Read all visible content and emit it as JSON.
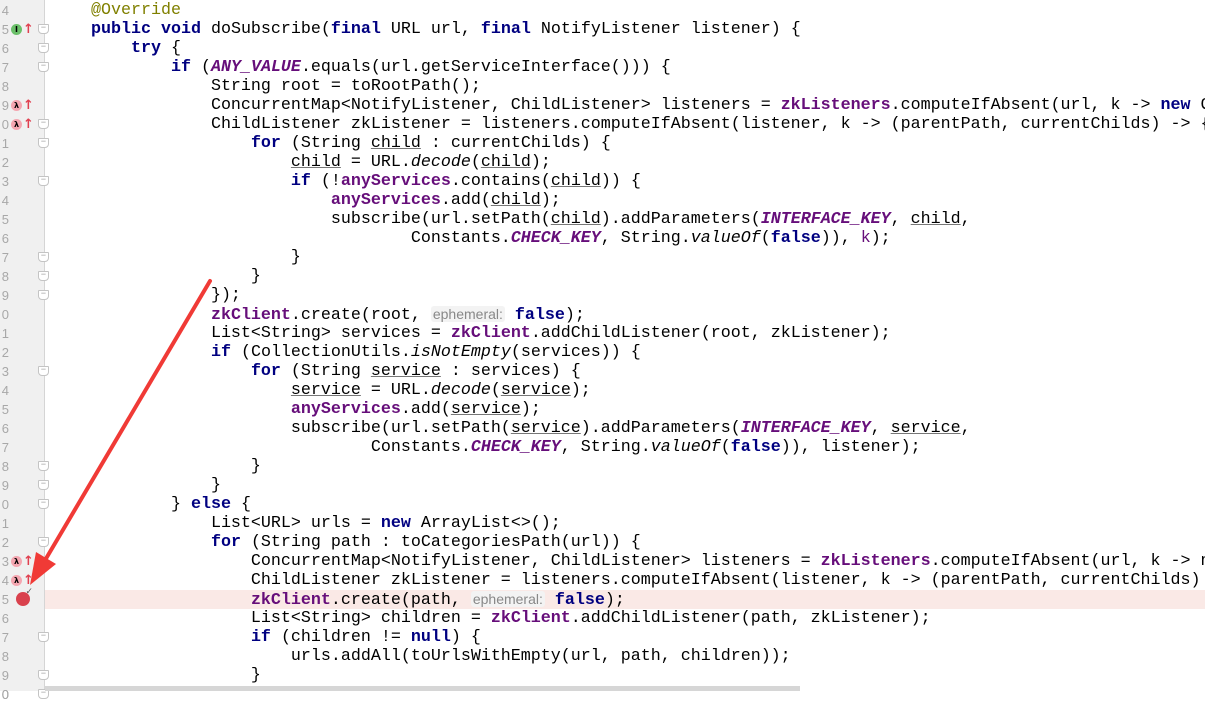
{
  "editor": {
    "line_numbers": [
      "4",
      "5",
      "6",
      "7",
      "8",
      "9",
      "0",
      "1",
      "2",
      "3",
      "4",
      "5",
      "6",
      "7",
      "8",
      "9",
      "0",
      "1",
      "2",
      "3",
      "4",
      "5",
      "6",
      "7",
      "8",
      "9",
      "0",
      "1",
      "2",
      "3",
      "4",
      "5",
      "6",
      "7",
      "8",
      "9",
      "0"
    ],
    "highlighted_line": 31,
    "breakpoint_line": 31,
    "gutter_icons": [
      {
        "line": 1,
        "icon": "implements-method-icon",
        "label": "I",
        "color": "#6abf69"
      },
      {
        "line": 5,
        "icon": "lambda-icon",
        "label": "λ",
        "color": "#f4a6b0"
      },
      {
        "line": 6,
        "icon": "lambda-icon",
        "label": "λ",
        "color": "#f4a6b0"
      },
      {
        "line": 29,
        "icon": "lambda-icon",
        "label": "λ",
        "color": "#f4a6b0"
      },
      {
        "line": 30,
        "icon": "lambda-icon",
        "label": "λ",
        "color": "#f4a6b0"
      }
    ],
    "fold_lines": [
      1,
      2,
      3,
      6,
      7,
      9,
      13,
      14,
      15,
      19,
      24,
      25,
      26,
      28,
      33,
      35,
      36
    ],
    "lines": [
      [
        [
          "a",
          "@Override"
        ]
      ],
      [
        [
          "k",
          "public void "
        ],
        [
          "p",
          "doSubscribe("
        ],
        [
          "k",
          "final "
        ],
        [
          "p",
          "URL url, "
        ],
        [
          "k",
          "final "
        ],
        [
          "p",
          "NotifyListener listener) {"
        ]
      ],
      [
        [
          "p",
          "    "
        ],
        [
          "k",
          "try "
        ],
        [
          "p",
          "{"
        ]
      ],
      [
        [
          "p",
          "        "
        ],
        [
          "k",
          "if "
        ],
        [
          "p",
          "("
        ],
        [
          "c",
          "ANY_VALUE"
        ],
        [
          "p",
          ".equals(url.getServiceInterface())) {"
        ]
      ],
      [
        [
          "p",
          "            String root = toRootPath();"
        ]
      ],
      [
        [
          "p",
          "            ConcurrentMap<NotifyListener, ChildListener> listeners = "
        ],
        [
          "f",
          "zkListeners"
        ],
        [
          "p",
          ".computeIfAbsent(url, k -> "
        ],
        [
          "k",
          "new "
        ],
        [
          "p",
          "C"
        ]
      ],
      [
        [
          "p",
          "            ChildListener zkListener = listeners.computeIfAbsent(listener, k -> (parentPath, currentChilds) -> {"
        ]
      ],
      [
        [
          "p",
          "                "
        ],
        [
          "k",
          "for "
        ],
        [
          "p",
          "(String "
        ],
        [
          "u",
          "child"
        ],
        [
          "p",
          " : currentChilds) {"
        ]
      ],
      [
        [
          "p",
          "                    "
        ],
        [
          "u",
          "child"
        ],
        [
          "p",
          " = URL."
        ],
        [
          "s",
          "decode"
        ],
        [
          "p",
          "("
        ],
        [
          "u",
          "child"
        ],
        [
          "p",
          ");"
        ]
      ],
      [
        [
          "p",
          "                    "
        ],
        [
          "k",
          "if "
        ],
        [
          "p",
          "(!"
        ],
        [
          "f",
          "anyServices"
        ],
        [
          "p",
          ".contains("
        ],
        [
          "u",
          "child"
        ],
        [
          "p",
          ")) {"
        ]
      ],
      [
        [
          "p",
          "                        "
        ],
        [
          "f",
          "anyServices"
        ],
        [
          "p",
          ".add("
        ],
        [
          "u",
          "child"
        ],
        [
          "p",
          ");"
        ]
      ],
      [
        [
          "p",
          "                        subscribe(url.setPath("
        ],
        [
          "u",
          "child"
        ],
        [
          "p",
          ").addParameters("
        ],
        [
          "c",
          "INTERFACE_KEY"
        ],
        [
          "p",
          ", "
        ],
        [
          "u",
          "child"
        ],
        [
          "p",
          ","
        ]
      ],
      [
        [
          "p",
          "                                Constants."
        ],
        [
          "c",
          "CHECK_KEY"
        ],
        [
          "p",
          ", String."
        ],
        [
          "s",
          "valueOf"
        ],
        [
          "p",
          "("
        ],
        [
          "k",
          "false"
        ],
        [
          "p",
          ")), "
        ],
        [
          "v",
          "k"
        ],
        [
          "p",
          ");"
        ]
      ],
      [
        [
          "p",
          "                    }"
        ]
      ],
      [
        [
          "p",
          "                }"
        ]
      ],
      [
        [
          "p",
          "            });"
        ]
      ],
      [
        [
          "p",
          "            "
        ],
        [
          "f",
          "zkClient"
        ],
        [
          "p",
          ".create(root, "
        ],
        [
          "h",
          "ephemeral:"
        ],
        [
          "p",
          " "
        ],
        [
          "k",
          "false"
        ],
        [
          "p",
          ");"
        ]
      ],
      [
        [
          "p",
          "            List<String> services = "
        ],
        [
          "f",
          "zkClient"
        ],
        [
          "p",
          ".addChildListener(root, zkListener);"
        ]
      ],
      [
        [
          "p",
          "            "
        ],
        [
          "k",
          "if "
        ],
        [
          "p",
          "(CollectionUtils."
        ],
        [
          "s",
          "isNotEmpty"
        ],
        [
          "p",
          "(services)) {"
        ]
      ],
      [
        [
          "p",
          "                "
        ],
        [
          "k",
          "for "
        ],
        [
          "p",
          "(String "
        ],
        [
          "u",
          "service"
        ],
        [
          "p",
          " : services) {"
        ]
      ],
      [
        [
          "p",
          "                    "
        ],
        [
          "u",
          "service"
        ],
        [
          "p",
          " = URL."
        ],
        [
          "s",
          "decode"
        ],
        [
          "p",
          "("
        ],
        [
          "u",
          "service"
        ],
        [
          "p",
          ");"
        ]
      ],
      [
        [
          "p",
          "                    "
        ],
        [
          "f",
          "anyServices"
        ],
        [
          "p",
          ".add("
        ],
        [
          "u",
          "service"
        ],
        [
          "p",
          ");"
        ]
      ],
      [
        [
          "p",
          "                    subscribe(url.setPath("
        ],
        [
          "u",
          "service"
        ],
        [
          "p",
          ").addParameters("
        ],
        [
          "c",
          "INTERFACE_KEY"
        ],
        [
          "p",
          ", "
        ],
        [
          "u",
          "service"
        ],
        [
          "p",
          ","
        ]
      ],
      [
        [
          "p",
          "                            Constants."
        ],
        [
          "c",
          "CHECK_KEY"
        ],
        [
          "p",
          ", String."
        ],
        [
          "s",
          "valueOf"
        ],
        [
          "p",
          "("
        ],
        [
          "k",
          "false"
        ],
        [
          "p",
          ")), listener);"
        ]
      ],
      [
        [
          "p",
          "                }"
        ]
      ],
      [
        [
          "p",
          "            }"
        ]
      ],
      [
        [
          "p",
          "        } "
        ],
        [
          "k",
          "else "
        ],
        [
          "p",
          "{"
        ]
      ],
      [
        [
          "p",
          "            List<URL> urls = "
        ],
        [
          "k",
          "new "
        ],
        [
          "p",
          "ArrayList<>();"
        ]
      ],
      [
        [
          "p",
          "            "
        ],
        [
          "k",
          "for "
        ],
        [
          "p",
          "(String path : toCategoriesPath(url)) {"
        ]
      ],
      [
        [
          "p",
          "                ConcurrentMap<NotifyListener, ChildListener> listeners = "
        ],
        [
          "f",
          "zkListeners"
        ],
        [
          "p",
          ".computeIfAbsent(url, k -> n"
        ]
      ],
      [
        [
          "p",
          "                ChildListener zkListener = listeners.computeIfAbsent(listener, k -> (parentPath, currentChilds)"
        ]
      ],
      [
        [
          "p",
          "                "
        ],
        [
          "f",
          "zkClient"
        ],
        [
          "p",
          ".create(path, "
        ],
        [
          "h",
          "ephemeral:"
        ],
        [
          "p",
          " "
        ],
        [
          "k",
          "false"
        ],
        [
          "p",
          ");"
        ]
      ],
      [
        [
          "p",
          "                List<String> children = "
        ],
        [
          "f",
          "zkClient"
        ],
        [
          "p",
          ".addChildListener(path, zkListener);"
        ]
      ],
      [
        [
          "p",
          "                "
        ],
        [
          "k",
          "if "
        ],
        [
          "p",
          "(children != "
        ],
        [
          "k",
          "null"
        ],
        [
          "p",
          ") {"
        ]
      ],
      [
        [
          "p",
          "                    urls.addAll(toUrlsWithEmpty(url, path, children));"
        ]
      ],
      [
        [
          "p",
          "                }"
        ]
      ],
      [
        [
          "p",
          "            }"
        ]
      ]
    ]
  },
  "annotation": {
    "arrow_color": "#f03a36"
  }
}
